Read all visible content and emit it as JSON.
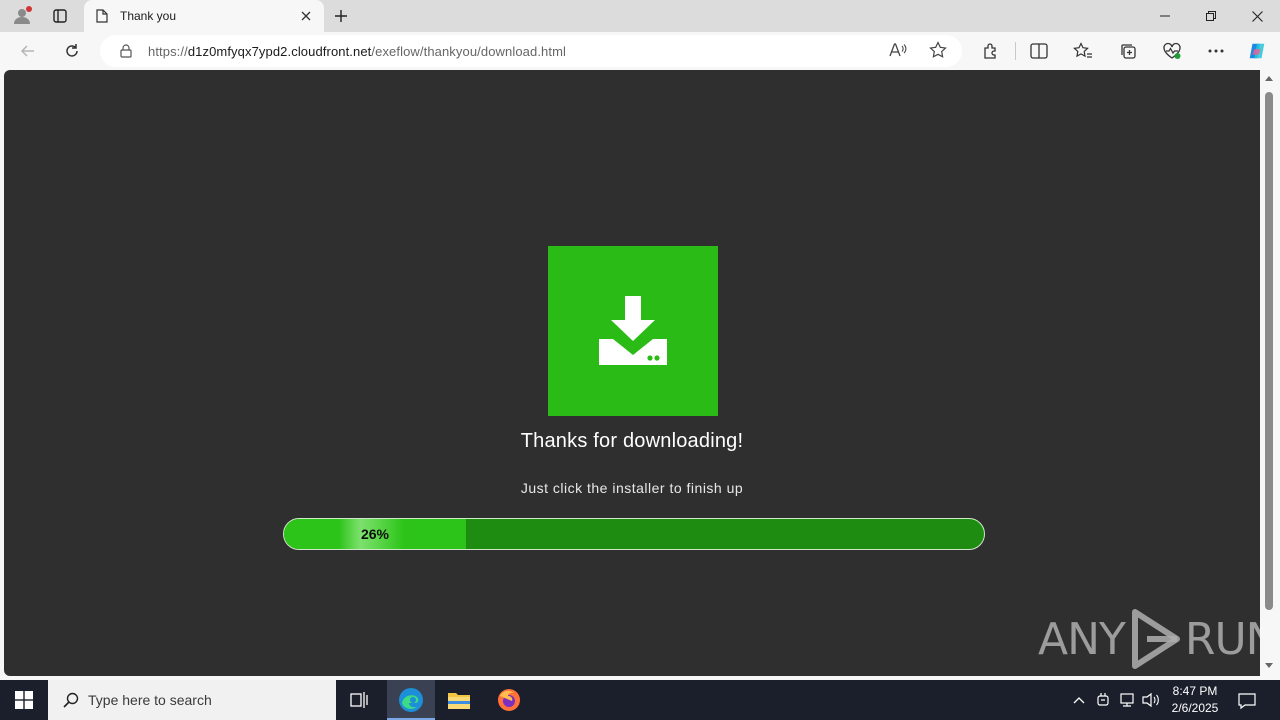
{
  "browser": {
    "tab": {
      "title": "Thank you"
    },
    "address": {
      "scheme": "https://",
      "host": "d1z0mfyqx7ypd2.cloudfront.net",
      "path": "/exeflow/thankyou/download.html"
    }
  },
  "page": {
    "headline": "Thanks for downloading!",
    "subline": "Just click the installer to finish up",
    "progress": {
      "percent": 26,
      "label": "26%"
    },
    "watermark": {
      "left": "ANY",
      "right": "RUN"
    }
  },
  "taskbar": {
    "search_placeholder": "Type here to search",
    "clock": {
      "time": "8:47 PM",
      "date": "2/6/2025"
    }
  },
  "colors": {
    "page_background": "#2f2f2f",
    "download_tile": "#2bbb16",
    "progress_fill": "#2cc419",
    "progress_track": "#1e8c10"
  },
  "icons": [
    "profile-icon",
    "tab-actions-icon",
    "page-favicon-icon",
    "close-icon",
    "plus-icon",
    "minimize-icon",
    "restore-icon",
    "back-icon",
    "refresh-icon",
    "lock-icon",
    "read-aloud-icon",
    "favorite-star-icon",
    "extensions-icon",
    "split-screen-icon",
    "favorites-icon",
    "collections-icon",
    "browser-essentials-icon",
    "more-icon",
    "copilot-icon",
    "download-icon",
    "windows-logo-icon",
    "search-icon",
    "task-view-icon",
    "edge-icon",
    "file-explorer-icon",
    "firefox-icon",
    "chevron-up-icon",
    "network-icon",
    "volume-icon",
    "notification-icon"
  ]
}
